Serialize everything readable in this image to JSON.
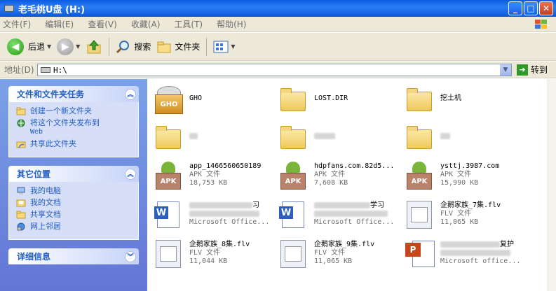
{
  "window": {
    "title": "老毛桃U盘 (H:)",
    "minimize": "_",
    "maximize": "□",
    "close": "✕"
  },
  "menu": [
    "文件(F)",
    "编辑(E)",
    "查看(V)",
    "收藏(A)",
    "工具(T)",
    "帮助(H)"
  ],
  "toolbar": {
    "back": "后退",
    "search": "搜索",
    "folders": "文件夹"
  },
  "address": {
    "label": "地址(D)",
    "value": "H:\\",
    "go": "转到"
  },
  "tasks": {
    "title": "文件和文件夹任务",
    "items": [
      {
        "label": "创建一个新文件夹",
        "icon": "new-folder-icon"
      },
      {
        "label": "将这个文件夹发布到",
        "sub": "Web",
        "icon": "publish-web-icon"
      },
      {
        "label": "共享此文件夹",
        "icon": "share-folder-icon"
      }
    ]
  },
  "places": {
    "title": "其它位置",
    "items": [
      {
        "label": "我的电脑",
        "icon": "my-computer-icon"
      },
      {
        "label": "我的文档",
        "icon": "my-documents-icon"
      },
      {
        "label": "共享文档",
        "icon": "shared-documents-icon"
      },
      {
        "label": "网上邻居",
        "icon": "network-icon"
      }
    ]
  },
  "details": {
    "title": "详细信息"
  },
  "files": [
    {
      "name": "GHO",
      "type": "",
      "size": "",
      "kind": "gho"
    },
    {
      "name": "LOST.DIR",
      "type": "",
      "size": "",
      "kind": "folder"
    },
    {
      "name": "挖土机",
      "type": "",
      "size": "",
      "kind": "folder"
    },
    {
      "name": "",
      "type": "",
      "size": "",
      "kind": "folder"
    },
    {
      "name": "",
      "type": "",
      "size": "",
      "kind": "folder"
    },
    {
      "name": "",
      "type": "",
      "size": "",
      "kind": "folder"
    },
    {
      "name": "app_1466560650189",
      "type": "APK 文件",
      "size": "18,753 KB",
      "kind": "apk"
    },
    {
      "name": "hdpfans.com.82d5...",
      "type": "APK 文件",
      "size": "7,608 KB",
      "kind": "apk"
    },
    {
      "name": "ysttj.3987.com",
      "type": "APK 文件",
      "size": "15,990 KB",
      "kind": "apk"
    },
    {
      "name": "习",
      "type": "",
      "size": "Microsoft Office...",
      "kind": "doc"
    },
    {
      "name": "学习",
      "type": "",
      "size": "Microsoft Office...",
      "kind": "doc"
    },
    {
      "name": "企鹅家族_7集.flv",
      "type": "FLV 文件",
      "size": "11,065 KB",
      "kind": "flv"
    },
    {
      "name": "企鹅家族_8集.flv",
      "type": "FLV 文件",
      "size": "11,044 KB",
      "kind": "flv"
    },
    {
      "name": "企鹅家族_9集.flv",
      "type": "FLV 文件",
      "size": "11,065 KB",
      "kind": "flv"
    },
    {
      "name": "复护",
      "type": "",
      "size": "Microsoft office...",
      "kind": "ppt"
    }
  ],
  "apk_badge": "APK",
  "gho_badge": "GHO",
  "word_badge": "W",
  "ppt_badge": "P"
}
